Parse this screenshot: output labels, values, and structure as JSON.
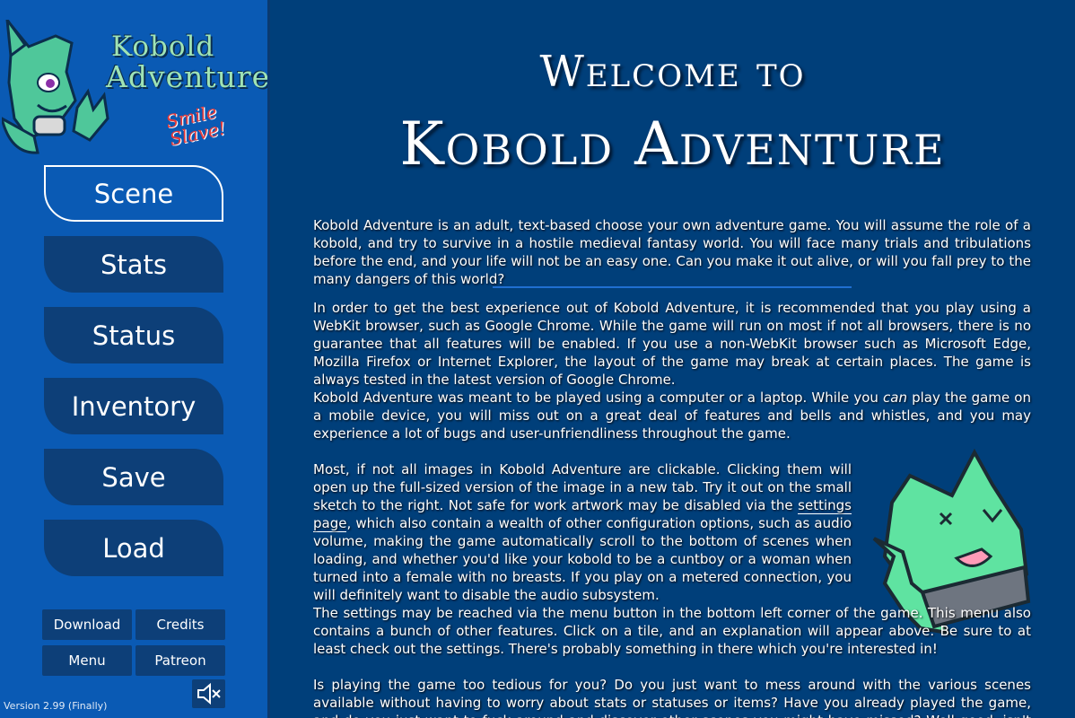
{
  "sidebar": {
    "logo": {
      "line1": "Kobold",
      "line2": "Adventure",
      "tagline": "Smile Slave!"
    },
    "nav": [
      {
        "label": "Scene",
        "active": true
      },
      {
        "label": "Stats"
      },
      {
        "label": "Status"
      },
      {
        "label": "Inventory"
      },
      {
        "label": "Save"
      },
      {
        "label": "Load"
      }
    ],
    "buttons": {
      "download": "Download",
      "credits": "Credits",
      "menu": "Menu",
      "patreon": "Patreon"
    },
    "mute_icon": "speaker-muted-icon",
    "version": "Version 2.99 (Finally)"
  },
  "main": {
    "welcome": "Welcome to",
    "title": "Kobold Adventure",
    "p1": "Kobold Adventure is an adult, text-based choose your own adventure game. You will assume the role of a kobold, and try to survive in a hostile medieval fantasy world. You will face many trials and tribulations before the end, and your life will not be an easy one. Can you make it out alive, or will you fall prey to the many dangers of this world?",
    "p2": "In order to get the best experience out of Kobold Adventure, it is recommended that you play using a WebKit browser, such as Google Chrome. While the game will run on most if not all browsers, there is no guarantee that all features will be enabled. If you use a non-WebKit browser such as Microsoft Edge, Mozilla Firefox or Internet Explorer, the layout of the game may break at certain places. The game is always tested in the latest version of Google Chrome.",
    "p3_before": "Kobold Adventure was meant to be played using a computer or a laptop. While you ",
    "p3_em": "can",
    "p3_after": " play the game on a mobile device, you will miss out on a great deal of features and bells and whistles, and you may experience a lot of bugs and user-unfriendliness throughout the game.",
    "p4_before": "Most, if not all images in Kobold Adventure are clickable. Clicking them will open up the full-sized version of the image in a new tab. Try it out on the small sketch to the right. Not safe for work artwork may be disabled via the ",
    "p4_link": "settings page",
    "p4_after": ", which also contain a wealth of other configuration options, such as audio volume, making the game automatically scroll to the bottom of scenes when loading, and whether you'd like your kobold to be a cuntboy or a woman when turned into a female with no breasts. If you play on a metered connection, you will definitely want to disable the audio subsystem.",
    "p5": "The settings may be reached via the menu button in the bottom left corner of the game. This menu also contains a bunch of other features. Click on a tile, and an explanation will appear above. Be sure to at least check out the settings. There's probably something in there which you're interested in!",
    "p6": "Is playing the game too tedious for you? Do you just want to mess around with the various scenes available without having to worry about stats or statuses or items? Have you already played the game, and do you just want to fuck around and discover other scenes you might have missed? Well good, isn't Kobold Adventure also available. Click"
  },
  "colors": {
    "sidebar": "#0a5ab4",
    "main": "#003f7a",
    "button": "#0d3f78",
    "logo_text": "#9fe3b5",
    "kobold": "#5fe3a1"
  }
}
